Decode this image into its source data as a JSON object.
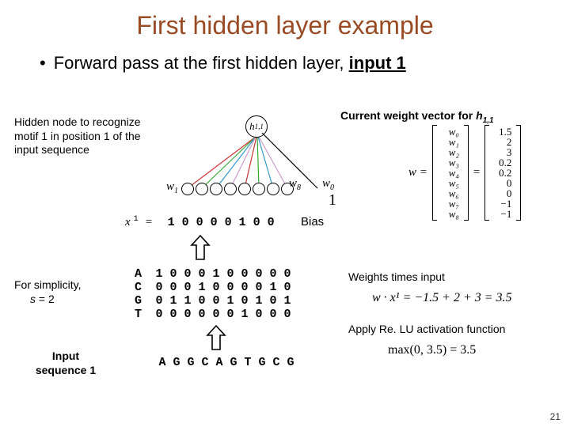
{
  "title": "First hidden layer example",
  "bullet": {
    "prefix": "Forward pass at the first hidden layer, ",
    "bold": "input 1"
  },
  "labels": {
    "hidden_node": "Hidden node to recognize motif 1 in position 1 of the input sequence",
    "current_weight": "Current weight vector for ",
    "current_weight_sym": "h",
    "current_weight_sub": "1,1",
    "for_simplicity_1": "For simplicity,",
    "for_simplicity_2": "s",
    "for_simplicity_3": " = 2",
    "input_seq_1": "Input",
    "input_seq_2": "sequence 1",
    "bias": "Bias",
    "wti": "Weights times input",
    "relu": "Apply Re. LU activation function"
  },
  "diagram": {
    "h_label": "h",
    "h_sub": "1,1",
    "w1": "w",
    "w1_sub": "1",
    "w8": "w",
    "w8_sub": "8",
    "w0": "w",
    "w0_sub": "0",
    "one": "1"
  },
  "x1": {
    "sym": "x",
    "sup": "1",
    "eq": "=",
    "digits": [
      "1",
      "0",
      "0",
      "0",
      "0",
      "1",
      "0",
      "0"
    ]
  },
  "encoding": {
    "rows": [
      {
        "lab": "A",
        "cells": [
          "1",
          "0",
          "0",
          "0",
          "1",
          "0",
          "0",
          "0",
          "0",
          "0"
        ]
      },
      {
        "lab": "C",
        "cells": [
          "0",
          "0",
          "0",
          "1",
          "0",
          "0",
          "0",
          "0",
          "1",
          "0"
        ]
      },
      {
        "lab": "G",
        "cells": [
          "0",
          "1",
          "1",
          "0",
          "0",
          "1",
          "0",
          "1",
          "0",
          "1"
        ]
      },
      {
        "lab": "T",
        "cells": [
          "0",
          "0",
          "0",
          "0",
          "0",
          "0",
          "1",
          "0",
          "0",
          "0"
        ]
      }
    ]
  },
  "sequence": [
    "A",
    "G",
    "G",
    "C",
    "A",
    "G",
    "T",
    "G",
    "C",
    "G"
  ],
  "weights": {
    "names": [
      "w₀",
      "w₁",
      "w₂",
      "w₃",
      "w₄",
      "w₅",
      "w₆",
      "w₇",
      "w₈"
    ],
    "vals": [
      "1.5",
      "2",
      "3",
      "0.2",
      "0.2",
      "0",
      "0",
      "−1",
      "−1"
    ],
    "lhs": "w ="
  },
  "eq1": "w · x¹ = −1.5 + 2 + 3 = 3.5",
  "eq2": "max(0, 3.5) = 3.5",
  "pagenum": "21"
}
